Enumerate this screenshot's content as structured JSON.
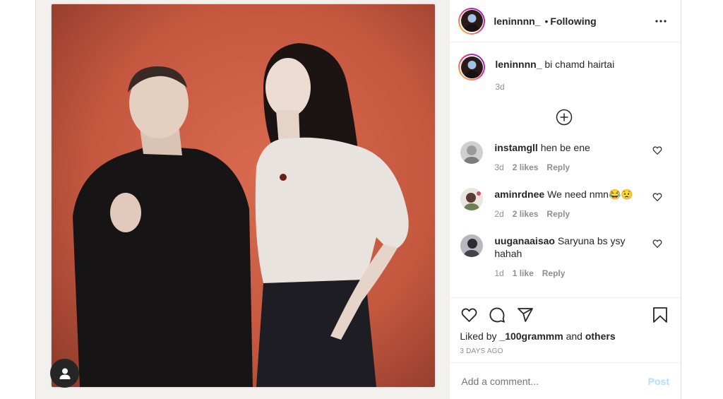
{
  "post": {
    "username": "leninnnn_",
    "separator": "•",
    "follow_status": "Following",
    "more_icon": "more-horizontal-icon",
    "tag_icon": "user-tag-icon"
  },
  "caption": {
    "username": "leninnnn_",
    "text": "bi chamd hairtai",
    "time": "3d"
  },
  "load_more_icon": "plus-circle-icon",
  "comments": [
    {
      "username": "instamgll",
      "text": "hen be ene",
      "time": "3d",
      "likes": "2 likes",
      "reply": "Reply"
    },
    {
      "username": "aminrdnee",
      "text": "We need nmn😂😟",
      "time": "2d",
      "likes": "2 likes",
      "reply": "Reply"
    },
    {
      "username": "uuganaaisao",
      "text": "Saryuna bs ysy hahah",
      "time": "1d",
      "likes": "1 like",
      "reply": "Reply"
    }
  ],
  "actions": {
    "icons": [
      "heart-icon",
      "comment-icon",
      "share-icon",
      "bookmark-icon"
    ],
    "liked_by_prefix": "Liked by",
    "liked_by_user": "_100grammm",
    "liked_by_and": "and",
    "liked_by_others": "others",
    "posted_ago": "3 DAYS AGO"
  },
  "add_comment": {
    "placeholder": "Add a comment...",
    "post_label": "Post"
  },
  "colors": {
    "accent_disabled": "#b2dffc",
    "text_primary": "#262626",
    "text_secondary": "#8e8e8e",
    "photo_background": "#c4583f"
  }
}
